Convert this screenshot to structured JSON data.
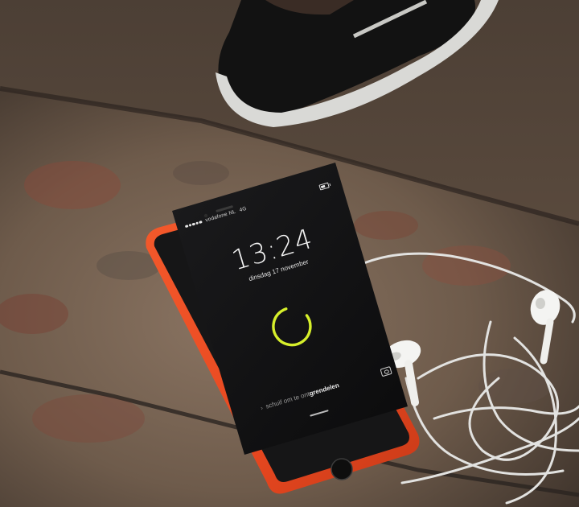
{
  "phone": {
    "status": {
      "carrier": "vodafone NL",
      "network": "4G"
    },
    "time": "13:24",
    "date": "dinsdag 17 november",
    "unlock_prefix": "schuif om te ont",
    "unlock_highlight": "grendelen",
    "spinner_progress": 0.8,
    "case_color": "#ee4a22",
    "spinner_color": "#d6ef2b",
    "icons": [
      "battery-icon",
      "camera-icon",
      "chevron-right-icon"
    ]
  }
}
